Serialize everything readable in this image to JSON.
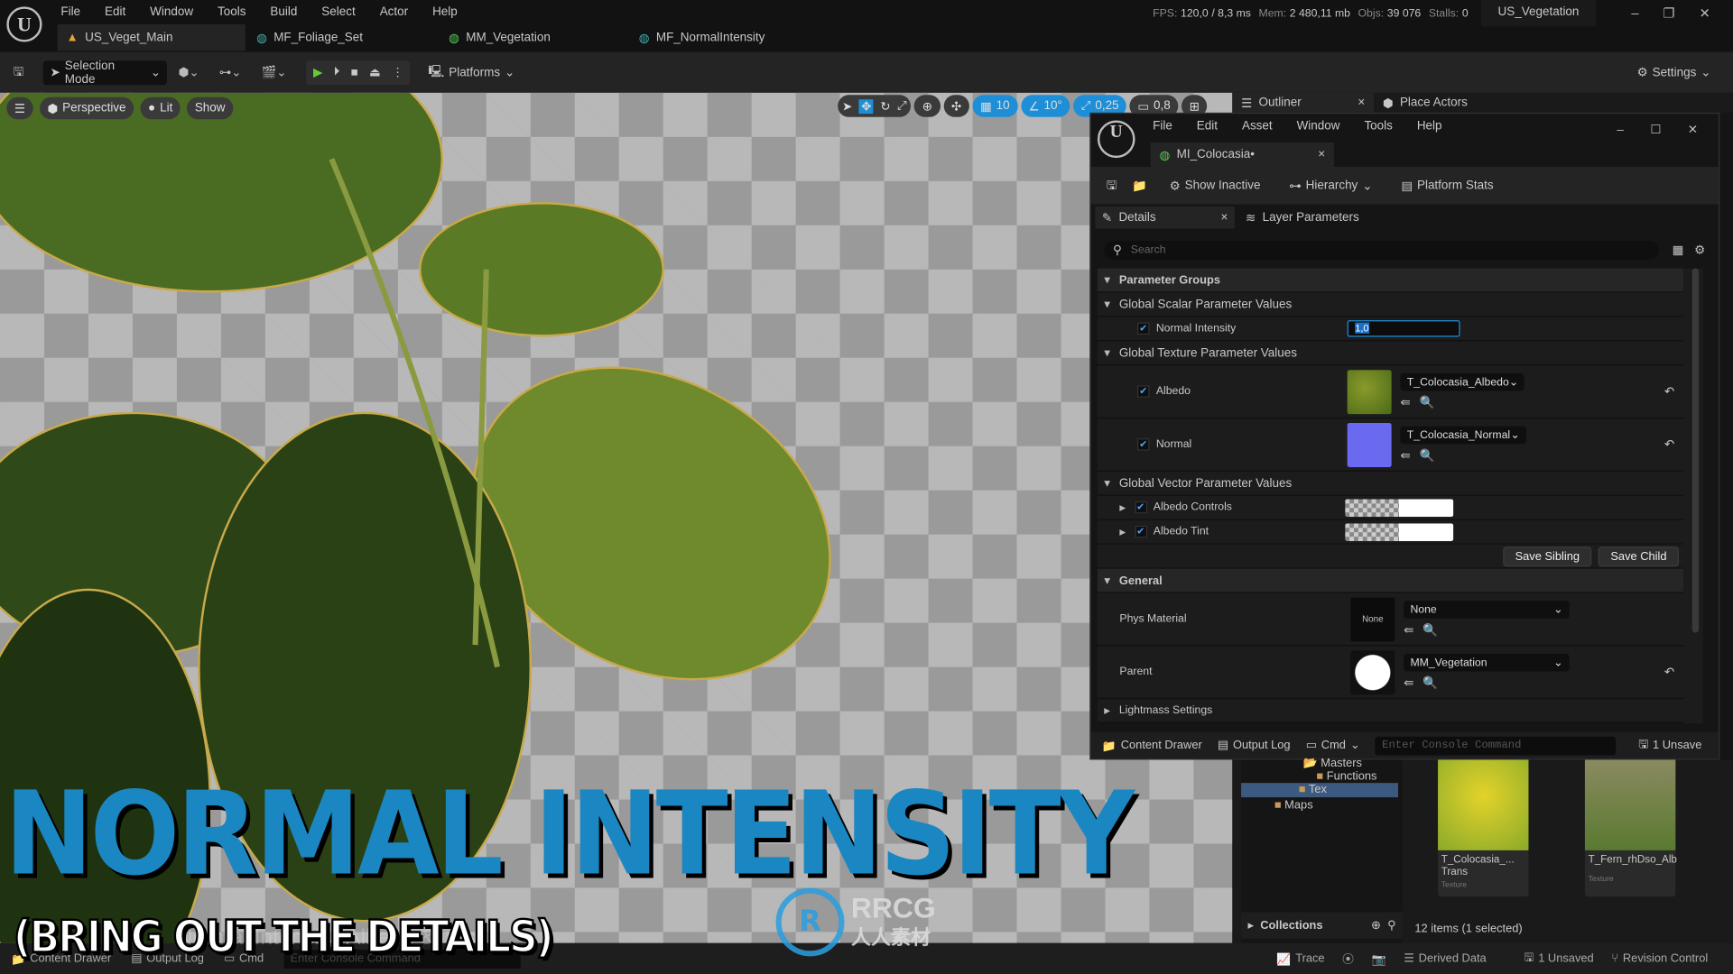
{
  "menu": [
    "File",
    "Edit",
    "Window",
    "Tools",
    "Build",
    "Select",
    "Actor",
    "Help"
  ],
  "tabs": [
    {
      "label": "US_Veget_Main",
      "icon": "level-icon"
    },
    {
      "label": "MF_Foliage_Set",
      "icon": "material-function-icon"
    },
    {
      "label": "MM_Vegetation",
      "icon": "material-icon"
    },
    {
      "label": "MF_NormalIntensity",
      "icon": "material-function-icon"
    }
  ],
  "stats": {
    "fps_label": "FPS:",
    "fps": "120,0",
    "ms": "/ 8,3 ms",
    "mem_label": "Mem:",
    "mem": "2 480,11 mb",
    "objs_label": "Objs:",
    "objs": "39 076",
    "stalls_label": "Stalls:",
    "stalls": "0"
  },
  "project": "US_Vegetation",
  "toolbar": {
    "selection_mode": "Selection Mode",
    "platforms": "Platforms",
    "settings": "Settings"
  },
  "viewport": {
    "perspective": "Perspective",
    "lit": "Lit",
    "show": "Show",
    "grid": "10",
    "angle": "10°",
    "scale": "0,25",
    "camera": "0,8"
  },
  "outliner": {
    "tab": "Outliner",
    "place_actors": "Place Actors"
  },
  "mi": {
    "menu": [
      "File",
      "Edit",
      "Asset",
      "Window",
      "Tools",
      "Help"
    ],
    "tab": "MI_Colocasia•",
    "show_inactive": "Show Inactive",
    "hierarchy": "Hierarchy",
    "platform_stats": "Platform Stats",
    "details": "Details",
    "layer_params": "Layer Parameters",
    "search_placeholder": "Search",
    "parameter_groups": "Parameter Groups",
    "scalar": "Global Scalar Parameter Values",
    "normal_intensity": "Normal Intensity",
    "normal_intensity_value": "1,0",
    "texture": "Global Texture Parameter Values",
    "albedo": "Albedo",
    "albedo_tex": "T_Colocasia_Albedo",
    "normal": "Normal",
    "normal_tex": "T_Colocasia_Normal",
    "vector": "Global Vector Parameter Values",
    "albedo_controls": "Albedo Controls",
    "albedo_tint": "Albedo Tint",
    "save_sibling": "Save Sibling",
    "save_child": "Save Child",
    "general": "General",
    "phys_material": "Phys Material",
    "phys_value": "None",
    "phys_thumb": "None",
    "parent": "Parent",
    "parent_value": "MM_Vegetation",
    "lightmass": "Lightmass Settings",
    "content_drawer": "Content Drawer",
    "output_log": "Output Log",
    "cmd": "Cmd",
    "console_placeholder": "Enter Console Command",
    "unsaved": "1 Unsave"
  },
  "content": {
    "folders": [
      "Masters",
      "Functions",
      "Tex",
      "Maps"
    ],
    "assets": [
      {
        "name": "T_Colocasia_...\nTrans",
        "type": "Texture"
      },
      {
        "name": "T_Fern_rhDso_Alb",
        "type": "Texture"
      }
    ],
    "collections": "Collections",
    "count": "12 items (1 selected)"
  },
  "statusbar": {
    "content_drawer": "Content Drawer",
    "output_log": "Output Log",
    "cmd": "Cmd",
    "console_placeholder": "Enter Console Command",
    "trace": "Trace",
    "derived": "Derived Data",
    "unsaved": "1 Unsaved",
    "revision": "Revision Control"
  },
  "overlay": {
    "title": "NORMAL INTENSITY",
    "subtitle": "(BRING OUT THE DETAILS)",
    "faded": "Normal Intensity, Albedo & Test",
    "watermark": "RRCG",
    "watermark_cn": "人人素材"
  },
  "colors": {
    "accent": "#1e8fd6",
    "title": "#1a87c2",
    "select": "#3c5a80"
  }
}
